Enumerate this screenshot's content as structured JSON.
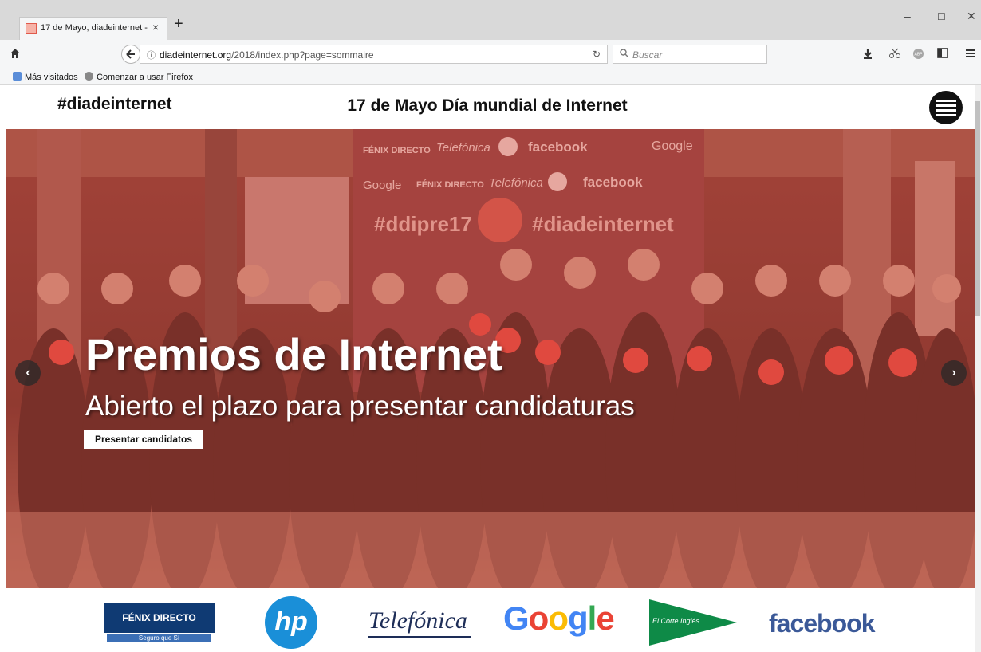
{
  "browser": {
    "tab_title": "17 de Mayo, diadeinternet -",
    "tab_close": "×",
    "new_tab": "+",
    "window_controls": {
      "minimize": "–",
      "maximize": "☐",
      "close": "✕"
    },
    "url_host": "diadeinternet.org",
    "url_path": "/2018/index.php?page=sommaire",
    "search_placeholder": "Buscar",
    "bookmarks": [
      "Más visitados",
      "Comenzar a usar Firefox"
    ]
  },
  "site": {
    "brand": "#diadeinternet",
    "headline": "17 de Mayo Día mundial de Internet"
  },
  "hero": {
    "title": "Premios de Internet",
    "subtitle": "Abierto el plazo para presentar candidaturas",
    "cta_label": "Presentar candidatos",
    "prev": "‹",
    "next": "›",
    "backdrop_banner_texts": [
      "FÉNIX DIRECTO",
      "Telefónica",
      "hp",
      "facebook",
      "Google",
      "#ddipre17",
      "#diadeinternet"
    ]
  },
  "sponsors": {
    "fenix": {
      "name": "FÉNIX DIRECTO",
      "tagline": "Seguro que Sí"
    },
    "hp": "hp",
    "telefonica": "Telefónica",
    "google": [
      "G",
      "o",
      "o",
      "g",
      "l",
      "e"
    ],
    "elcorteingles": "El Corte Inglés",
    "facebook": "facebook"
  },
  "colors": {
    "hero_overlay": "#d25046",
    "fenix_blue": "#0f3a73",
    "hp_blue": "#1a8fd8",
    "telefonica_navy": "#1d2d57",
    "facebook_blue": "#3b5998",
    "eci_green": "#0e8a47",
    "google": [
      "#4285f4",
      "#ea4335",
      "#fbbc05",
      "#4285f4",
      "#34a853",
      "#ea4335"
    ]
  }
}
